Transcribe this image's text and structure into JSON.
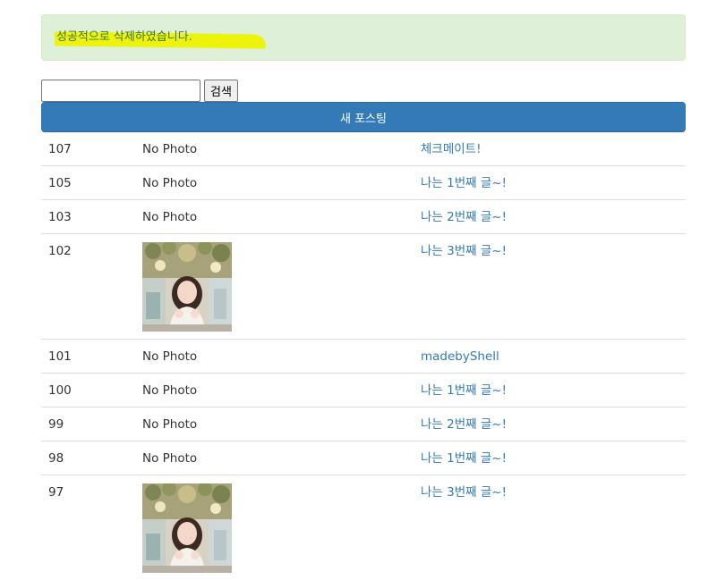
{
  "alert": {
    "message": "성공적으로 삭제하였습니다."
  },
  "search": {
    "value": "",
    "button_label": "검색"
  },
  "new_post": {
    "label": "새 포스팅"
  },
  "colors": {
    "primary": "#337ab7",
    "alert_bg": "#dff0d8",
    "alert_text": "#3c763d",
    "highlight": "#eef200"
  },
  "posts": [
    {
      "id": "107",
      "photo": "No Photo",
      "title": "체크메이트!"
    },
    {
      "id": "105",
      "photo": "No Photo",
      "title": "나는 1번째 글~!"
    },
    {
      "id": "103",
      "photo": "No Photo",
      "title": "나는 2번째 글~!"
    },
    {
      "id": "102",
      "photo": "",
      "has_image": true,
      "title": "나는 3번째 글~!"
    },
    {
      "id": "101",
      "photo": "No Photo",
      "title": "madebyShell"
    },
    {
      "id": "100",
      "photo": "No Photo",
      "title": "나는 1번째 글~!"
    },
    {
      "id": "99",
      "photo": "No Photo",
      "title": "나는 2번째 글~!"
    },
    {
      "id": "98",
      "photo": "No Photo",
      "title": "나는 1번째 글~!"
    },
    {
      "id": "97",
      "photo": "",
      "has_image": true,
      "title": "나는 3번째 글~!"
    }
  ]
}
